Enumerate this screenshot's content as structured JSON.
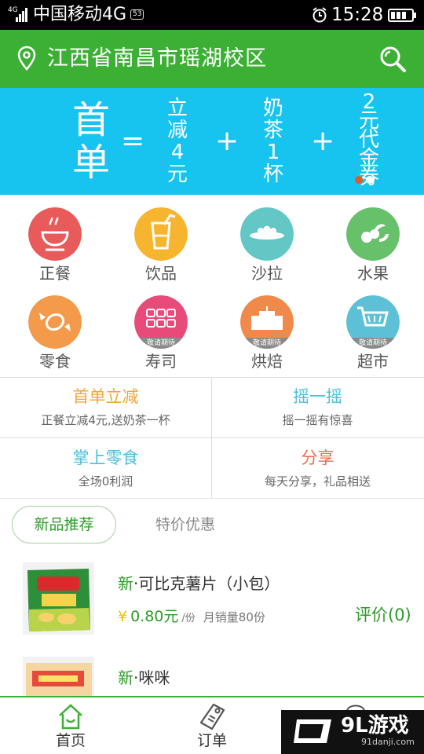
{
  "status_bar": {
    "network_tag": "4G",
    "carrier": "中国移动4G",
    "badge": "53",
    "time": "15:28"
  },
  "header": {
    "location": "江西省南昌市瑶湖校区"
  },
  "banner": {
    "first_order": "首单",
    "equals": "=",
    "plus": "+",
    "items": [
      {
        "lines": [
          "立",
          "减",
          "4",
          "元"
        ]
      },
      {
        "lines": [
          "奶",
          "茶",
          "1",
          "杯"
        ]
      },
      {
        "lines": [
          "2",
          "元",
          "代",
          "金",
          "券"
        ]
      }
    ]
  },
  "categories": [
    {
      "label": "正餐",
      "icon": "bowl-icon",
      "color": "#e95a5a"
    },
    {
      "label": "饮品",
      "icon": "drink-icon",
      "color": "#f7b42e"
    },
    {
      "label": "沙拉",
      "icon": "salad-icon",
      "color": "#63c7c6"
    },
    {
      "label": "水果",
      "icon": "fruit-icon",
      "color": "#67c06a"
    },
    {
      "label": "零食",
      "icon": "candy-icon",
      "color": "#f39a4b"
    },
    {
      "label": "寿司",
      "icon": "sushi-icon",
      "color": "#e84b7a",
      "ribbon": "敬请期待"
    },
    {
      "label": "烘焙",
      "icon": "cake-icon",
      "color": "#f08a4b",
      "ribbon": "敬请期待"
    },
    {
      "label": "超市",
      "icon": "cart-icon",
      "color": "#5cc1d6",
      "ribbon": "敬请期待"
    }
  ],
  "promos": [
    {
      "title": "首单立减",
      "subtitle": "正餐立减4元,送奶茶一杯",
      "color": "#f2a53a"
    },
    {
      "title": "摇一摇",
      "subtitle": "摇一摇有惊喜",
      "color": "#4bbfd9"
    },
    {
      "title": "掌上零食",
      "subtitle": "全场0利润",
      "color": "#4bbfd9"
    },
    {
      "title": "分享",
      "subtitle": "每天分享，礼品相送",
      "color": "#ef6a4e"
    }
  ],
  "tabs": {
    "new": "新品推荐",
    "sale": "特价优惠"
  },
  "products": [
    {
      "tag": "新",
      "name": "·可比克薯片（小包）",
      "yen": "¥",
      "price": "0.80元",
      "unit": "/份",
      "sales": "月销量80份",
      "review": "评价(0)"
    },
    {
      "tag": "新",
      "name": "·咪咪"
    }
  ],
  "bottom_nav": {
    "home": "首页",
    "orders": "订单"
  },
  "watermark": {
    "main": "9L游戏",
    "sub": "91danji.com"
  },
  "colors": {
    "brand_green": "#3cb034",
    "banner_blue": "#17c3ef"
  }
}
